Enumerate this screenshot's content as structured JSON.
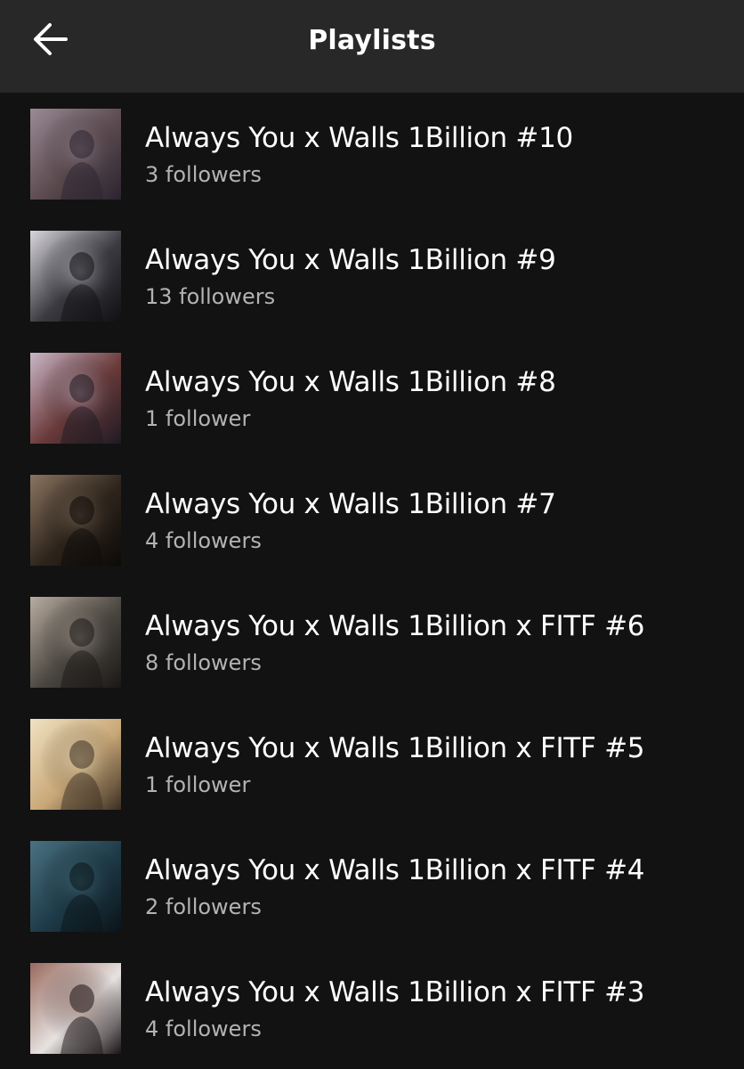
{
  "header": {
    "title": "Playlists",
    "back_icon": "arrow-left-icon"
  },
  "colors": {
    "background": "#121212",
    "header_background": "#282828",
    "primary_text": "#ffffff",
    "secondary_text": "#b3b3b3"
  },
  "playlists": [
    {
      "title": "Always You x Walls 1Billion #10",
      "followers": "3 followers",
      "cover": [
        "#5b4a4e",
        "#9a8a95",
        "#2b2430"
      ]
    },
    {
      "title": "Always You x Walls 1Billion #9",
      "followers": "13 followers",
      "cover": [
        "#3a3a40",
        "#d8d6dc",
        "#101014"
      ]
    },
    {
      "title": "Always You x Walls 1Billion #8",
      "followers": "1 follower",
      "cover": [
        "#6a3a3a",
        "#c9b6c6",
        "#1e1a22"
      ]
    },
    {
      "title": "Always You x Walls 1Billion #7",
      "followers": "4 followers",
      "cover": [
        "#2e241c",
        "#8a7460",
        "#0c0a08"
      ]
    },
    {
      "title": "Always You x Walls 1Billion x FITF #6",
      "followers": "8 followers",
      "cover": [
        "#4a4640",
        "#b8aca0",
        "#1a1816"
      ]
    },
    {
      "title": "Always You x Walls 1Billion x FITF #5",
      "followers": "1 follower",
      "cover": [
        "#c9a878",
        "#efe2c2",
        "#3a2e22"
      ]
    },
    {
      "title": "Always You x Walls 1Billion x FITF #4",
      "followers": "2 followers",
      "cover": [
        "#1e3a48",
        "#4a7282",
        "#0a1418"
      ]
    },
    {
      "title": "Always You x Walls 1Billion x FITF #3",
      "followers": "4 followers",
      "cover": [
        "#e6e2e0",
        "#9a6a5e",
        "#1a1416"
      ]
    }
  ]
}
